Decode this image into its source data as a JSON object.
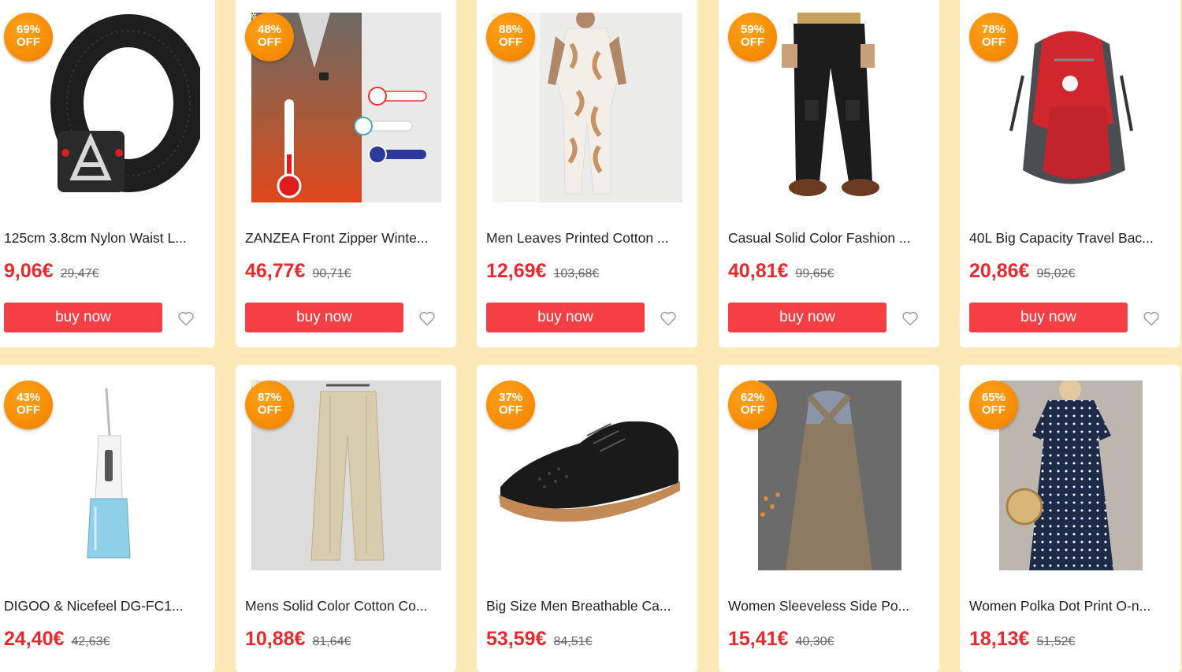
{
  "colors": {
    "page_background": "#fde9b8",
    "price_red": "#e8292e",
    "button_red": "#f63f44",
    "badge_orange": "#f58a00"
  },
  "buy_label": "buy now",
  "products": [
    {
      "discount": "69%",
      "off": "OFF",
      "title": "125cm 3.8cm Nylon Waist L...",
      "price": "9,06€",
      "old_price": "29,47€",
      "image": "black-tactical-belt"
    },
    {
      "discount": "48%",
      "off": "OFF",
      "title": "ZANZEA Front Zipper Winte...",
      "price": "46,77€",
      "old_price": "90,71€",
      "image": "heated-vest-thermometer"
    },
    {
      "discount": "88%",
      "off": "OFF",
      "title": "Men Leaves Printed Cotton ...",
      "price": "12,69€",
      "old_price": "103,68€",
      "image": "leaf-print-jumpsuit"
    },
    {
      "discount": "59%",
      "off": "OFF",
      "title": "Casual Solid Color Fashion ...",
      "price": "40,81€",
      "old_price": "99,65€",
      "image": "black-cargo-pants"
    },
    {
      "discount": "78%",
      "off": "OFF",
      "title": "40L Big Capacity Travel Bac...",
      "price": "20,86€",
      "old_price": "95,02€",
      "image": "red-hiking-backpack"
    },
    {
      "discount": "43%",
      "off": "OFF",
      "title": "DIGOO & Nicefeel DG-FC1...",
      "price": "24,40€",
      "old_price": "42,63€",
      "image": "water-flosser"
    },
    {
      "discount": "87%",
      "off": "OFF",
      "title": "Mens Solid Color Cotton Co...",
      "price": "10,88€",
      "old_price": "81,64€",
      "image": "khaki-trousers"
    },
    {
      "discount": "37%",
      "off": "OFF",
      "title": "Big Size Men Breathable Ca...",
      "price": "53,59€",
      "old_price": "84,51€",
      "image": "black-perforated-shoe"
    },
    {
      "discount": "62%",
      "off": "OFF",
      "title": "Women Sleeveless Side Po...",
      "price": "15,41€",
      "old_price": "40,30€",
      "image": "linen-apron-dress"
    },
    {
      "discount": "65%",
      "off": "OFF",
      "title": "Women Polka Dot Print O-n...",
      "price": "18,13€",
      "old_price": "51,52€",
      "image": "polka-dot-dress"
    }
  ]
}
